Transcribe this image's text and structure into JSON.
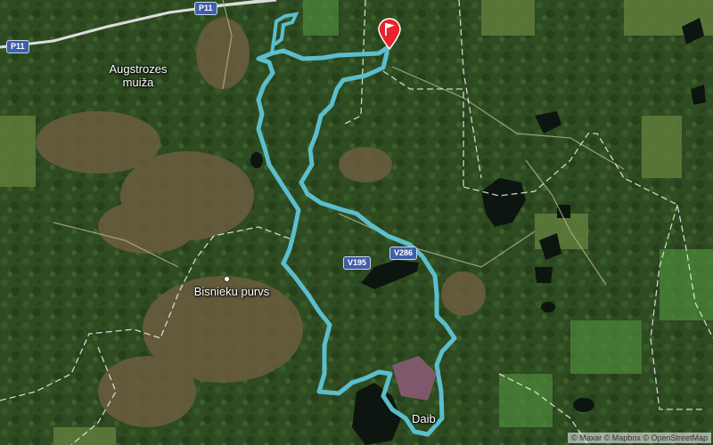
{
  "map": {
    "places": [
      {
        "name": "Augstrozes",
        "line2": "muiža"
      },
      {
        "name": "Bisnieku purvs"
      },
      {
        "name": "Daib"
      }
    ],
    "roads": [
      "P11",
      "P11",
      "V286",
      "V195"
    ],
    "attribution": "© Maxar © Mapbox © OpenStreetMap",
    "route_color": "#5fc4d6",
    "marker": {
      "icon": "flag-icon",
      "color": "#e8232b"
    }
  }
}
